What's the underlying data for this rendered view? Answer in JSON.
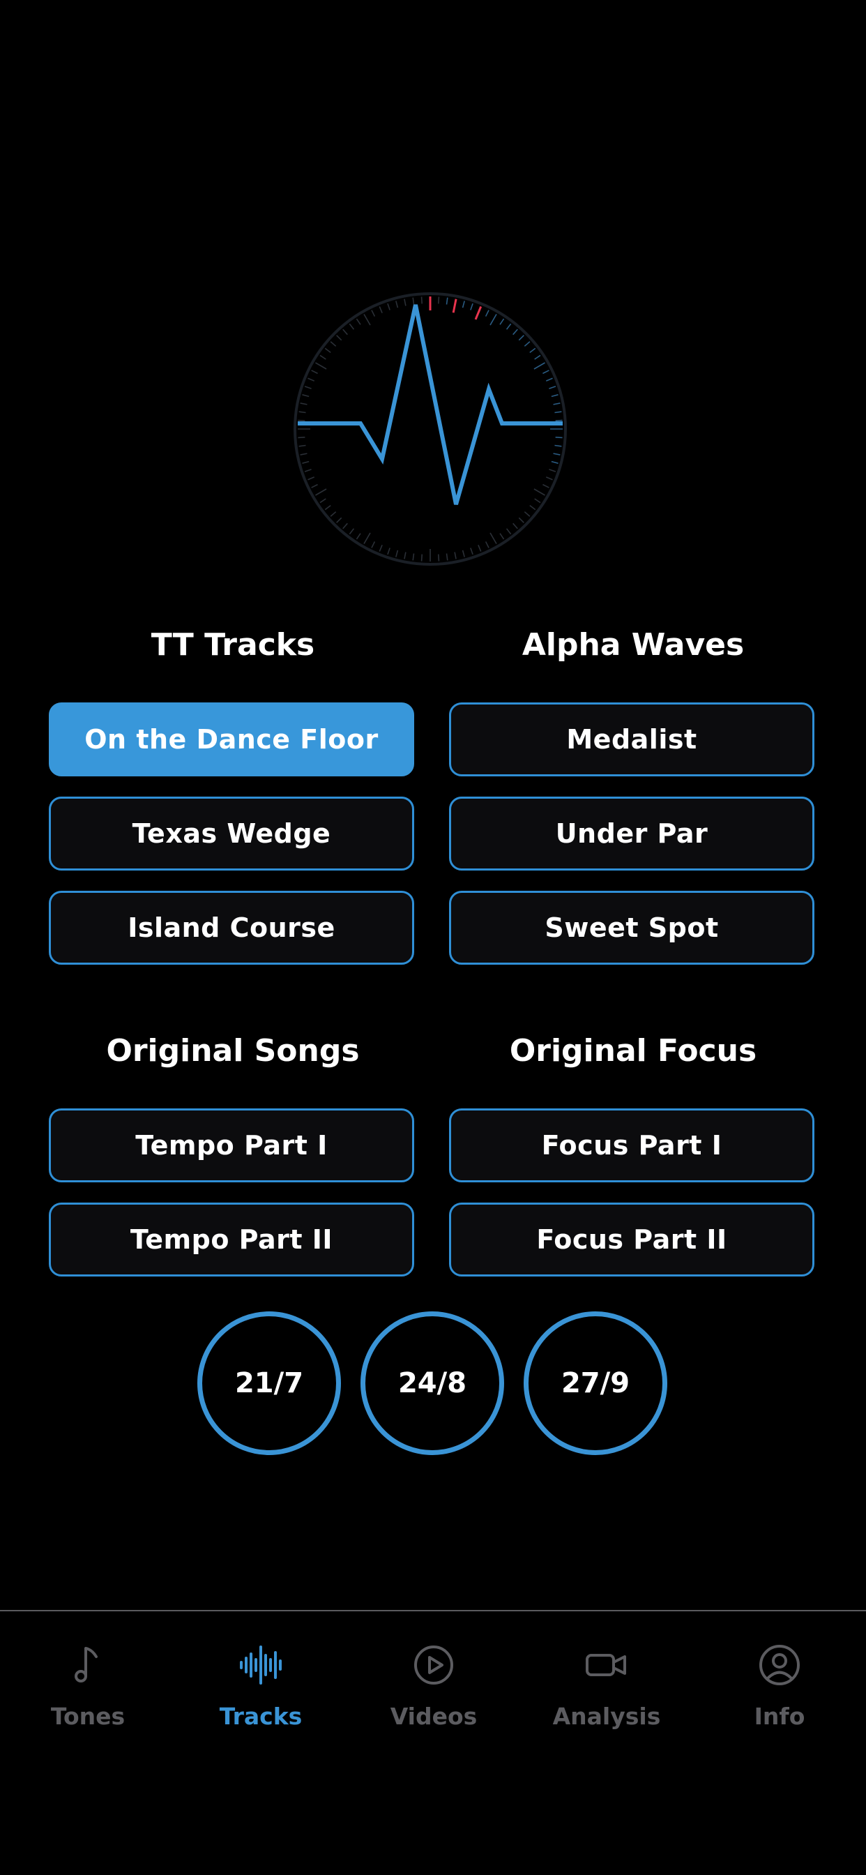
{
  "colors": {
    "accent": "#3897da",
    "background": "#000000",
    "button_bg": "#0c0c0e",
    "tab_inactive": "#5c5c60",
    "tick_red": "#e8344e"
  },
  "sections": [
    {
      "title": "TT Tracks",
      "buttons": [
        "On the Dance Floor",
        "Texas Wedge",
        "Island Course"
      ],
      "selected_index": 0
    },
    {
      "title": "Alpha Waves",
      "buttons": [
        "Medalist",
        "Under Par",
        "Sweet Spot"
      ]
    },
    {
      "title": "Original Songs",
      "buttons": [
        "Tempo Part I",
        "Tempo Part II"
      ]
    },
    {
      "title": "Original Focus",
      "buttons": [
        "Focus Part I",
        "Focus Part II"
      ]
    }
  ],
  "ratios": [
    "21/7",
    "24/8",
    "27/9"
  ],
  "tabs": [
    {
      "label": "Tones",
      "icon": "music-note-icon"
    },
    {
      "label": "Tracks",
      "icon": "waveform-icon",
      "active": true
    },
    {
      "label": "Videos",
      "icon": "play-circle-icon"
    },
    {
      "label": "Analysis",
      "icon": "video-camera-icon"
    },
    {
      "label": "Info",
      "icon": "user-circle-icon"
    }
  ]
}
